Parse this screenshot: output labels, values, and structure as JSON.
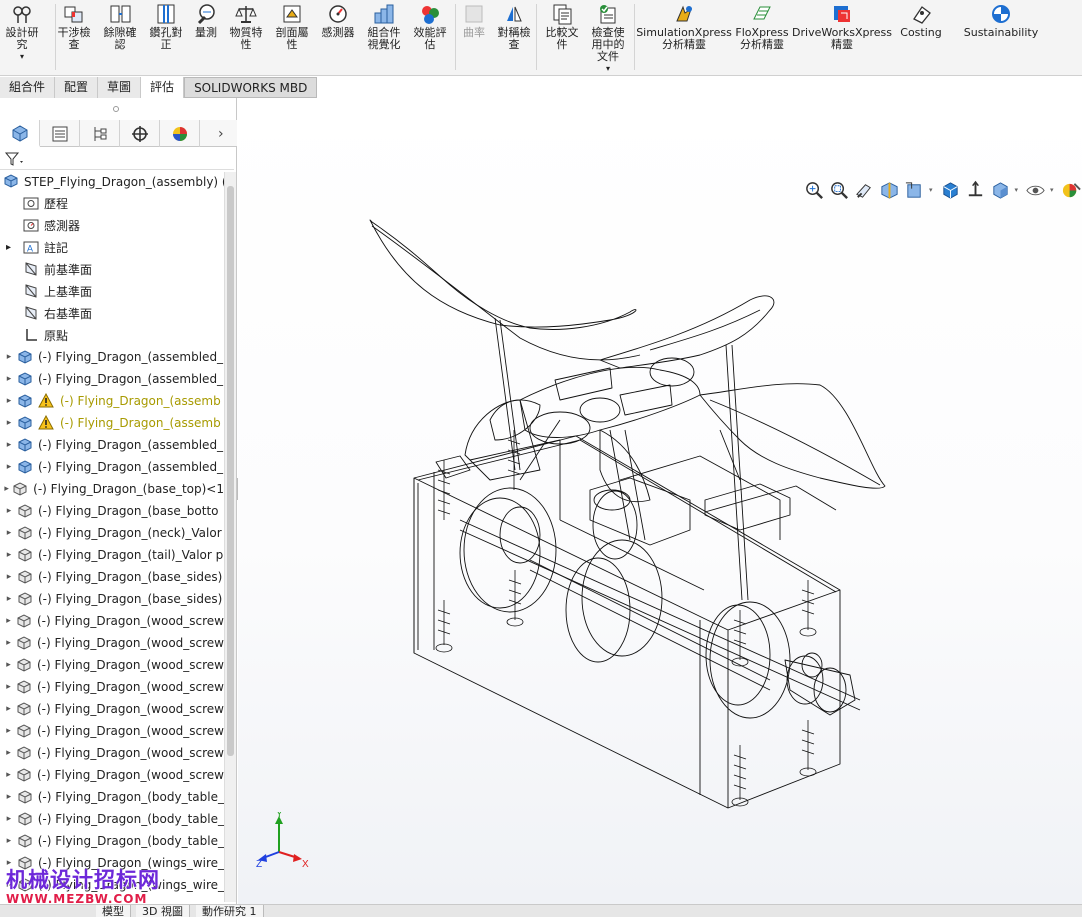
{
  "ribbon": {
    "buttons": [
      {
        "label": "設計研\n究",
        "icon": "design-study-icon"
      },
      {
        "label": "干涉檢\n查",
        "icon": "interference-check-icon"
      },
      {
        "label": "餘隙確\n認",
        "icon": "clearance-verification-icon"
      },
      {
        "label": "鑽孔對\n正",
        "icon": "hole-alignment-icon"
      },
      {
        "label": "量測",
        "icon": "measure-icon"
      },
      {
        "label": "物質特\n性",
        "icon": "mass-properties-icon"
      },
      {
        "label": "剖面屬\n性",
        "icon": "section-properties-icon"
      },
      {
        "label": "感測器",
        "icon": "sensor-icon"
      },
      {
        "label": "組合件\n視覺化",
        "icon": "assembly-visualization-icon"
      },
      {
        "label": "效能評\n估",
        "icon": "performance-evaluation-icon"
      },
      {
        "label": "曲率",
        "icon": "curvature-icon"
      },
      {
        "label": "對稱檢\n查",
        "icon": "symmetry-check-icon"
      },
      {
        "label": "比較文\n件",
        "icon": "compare-documents-icon"
      },
      {
        "label": "檢查使\n用中的\n文件",
        "icon": "check-active-document-icon"
      },
      {
        "label": "SimulationXpress\n分析精靈",
        "icon": "simulationxpress-icon"
      },
      {
        "label": "FloXpress\n分析精靈",
        "icon": "floxpress-icon"
      },
      {
        "label": "DriveWorksXpress\n精靈",
        "icon": "driveworksxpress-icon"
      },
      {
        "label": "Costing",
        "icon": "costing-icon"
      },
      {
        "label": "Sustainability",
        "icon": "sustainability-icon"
      }
    ]
  },
  "tabs": [
    "組合件",
    "配置",
    "草圖",
    "評估",
    "SOLIDWORKS MBD"
  ],
  "tree": {
    "root": "STEP_Flying_Dragon_(assembly)  (預",
    "features": [
      "歷程",
      "感測器",
      "註記",
      "前基準面",
      "上基準面",
      "右基準面",
      "原點"
    ],
    "components": [
      {
        "label": "(-) Flying_Dragon_(assembled_",
        "kind": "assembly"
      },
      {
        "label": "(-) Flying_Dragon_(assembled_",
        "kind": "assembly"
      },
      {
        "label": "(-) Flying_Dragon_(assemb",
        "kind": "warning"
      },
      {
        "label": "(-) Flying_Dragon_(assemb",
        "kind": "warning"
      },
      {
        "label": "(-) Flying_Dragon_(assembled_",
        "kind": "assembly"
      },
      {
        "label": "(-) Flying_Dragon_(assembled_",
        "kind": "assembly"
      },
      {
        "label": "(-) Flying_Dragon_(base_top)<1",
        "kind": "part"
      },
      {
        "label": "(-) Flying_Dragon_(base_botto",
        "kind": "part"
      },
      {
        "label": "(-) Flying_Dragon_(neck)_Valor",
        "kind": "part"
      },
      {
        "label": "(-) Flying_Dragon_(tail)_Valor p",
        "kind": "part"
      },
      {
        "label": "(-) Flying_Dragon_(base_sides)",
        "kind": "part"
      },
      {
        "label": "(-) Flying_Dragon_(base_sides)",
        "kind": "part"
      },
      {
        "label": "(-) Flying_Dragon_(wood_screw",
        "kind": "part"
      },
      {
        "label": "(-) Flying_Dragon_(wood_screw",
        "kind": "part"
      },
      {
        "label": "(-) Flying_Dragon_(wood_screw",
        "kind": "part"
      },
      {
        "label": "(-) Flying_Dragon_(wood_screw",
        "kind": "part"
      },
      {
        "label": "(-) Flying_Dragon_(wood_screw",
        "kind": "part"
      },
      {
        "label": "(-) Flying_Dragon_(wood_screw",
        "kind": "part"
      },
      {
        "label": "(-) Flying_Dragon_(wood_screw",
        "kind": "part"
      },
      {
        "label": "(-) Flying_Dragon_(wood_screw",
        "kind": "part"
      },
      {
        "label": "(-) Flying_Dragon_(body_table_",
        "kind": "part"
      },
      {
        "label": "(-) Flying_Dragon_(body_table_",
        "kind": "part"
      },
      {
        "label": "(-) Flying_Dragon_(body_table_",
        "kind": "part"
      },
      {
        "label": "(-) Flying_Dragon_(wings_wire_",
        "kind": "part"
      },
      {
        "label": "(-) Flying_Dragon_(wings_wire_",
        "kind": "part"
      }
    ]
  },
  "bottom_tabs": [
    "模型",
    "3D 視圖",
    "動作研究 1"
  ],
  "triad": {
    "x": "X",
    "y": "Y",
    "z": "Z"
  },
  "watermark": {
    "cn": "机械设计招标网",
    "url": "WWW.MEZBW.COM"
  },
  "colors": {
    "accent_blue": "#1e6fd1",
    "warning": "#a79a00",
    "axis_x": "#e02020",
    "axis_y": "#20a020",
    "axis_z": "#2040e0"
  }
}
